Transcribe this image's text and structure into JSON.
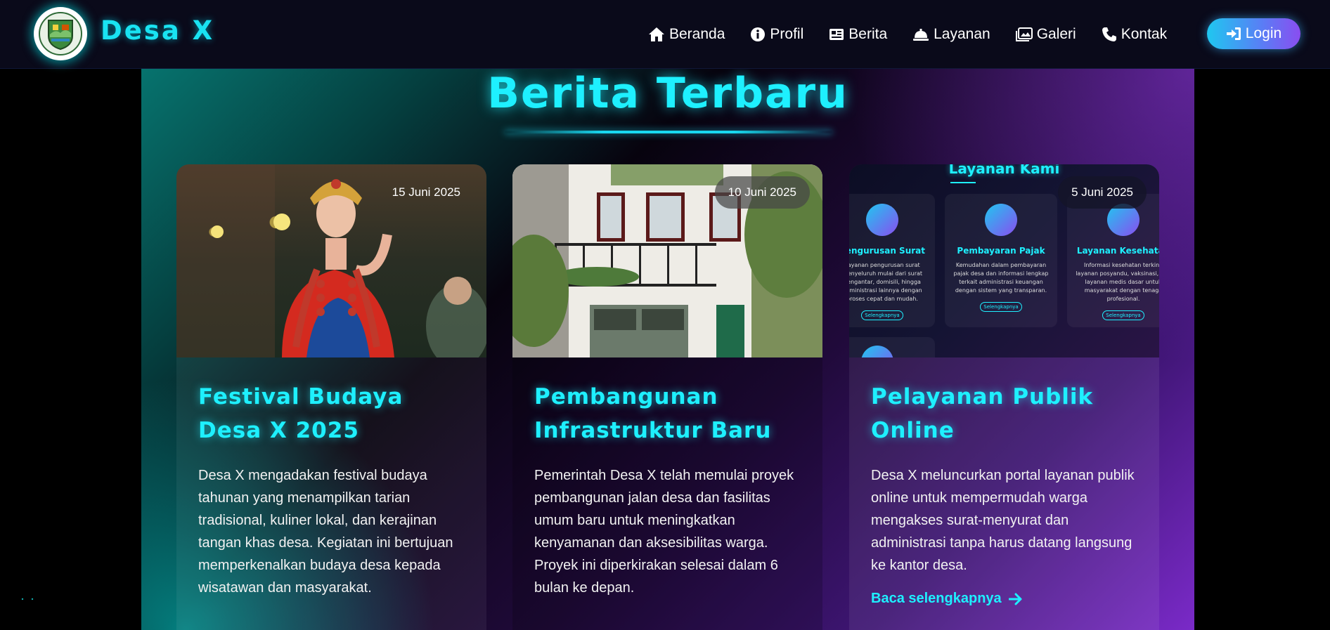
{
  "site": {
    "brand": "Desa X",
    "logo_text": "DESA X"
  },
  "nav": {
    "items": [
      {
        "label": "Beranda",
        "icon": "home-icon"
      },
      {
        "label": "Profil",
        "icon": "info-icon"
      },
      {
        "label": "Berita",
        "icon": "newspaper-icon"
      },
      {
        "label": "Layanan",
        "icon": "service-bell-icon"
      },
      {
        "label": "Galeri",
        "icon": "images-icon"
      },
      {
        "label": "Kontak",
        "icon": "phone-icon"
      }
    ],
    "login_label": "Login"
  },
  "section": {
    "title": "Berita Terbaru"
  },
  "cards": [
    {
      "date": "15 Juni 2025",
      "title": "Festival Budaya Desa X 2025",
      "text": "Desa X mengadakan festival budaya tahunan yang menampilkan tarian tradisional, kuliner lokal, dan kerajinan tangan khas desa. Kegiatan ini bertujuan memperkenalkan budaya desa kepada wisatawan dan masyarakat.",
      "read_more": ""
    },
    {
      "date": "10 Juni 2025",
      "title": "Pembangunan Infrastruktur Baru",
      "text": "Pemerintah Desa X telah memulai proyek pembangunan jalan desa dan fasilitas umum baru untuk meningkatkan kenyamanan dan aksesibilitas warga. Proyek ini diperkirakan selesai dalam 6 bulan ke depan.",
      "read_more": ""
    },
    {
      "date": "5 Juni 2025",
      "title": "Pelayanan Publik Online",
      "text": "Desa X meluncurkan portal layanan publik online untuk mempermudah warga mengakses surat-menyurat dan administrasi tanpa harus datang langsung ke kantor desa.",
      "read_more": "Baca selengkapnya"
    }
  ],
  "thumb3": {
    "heading": "Layanan Kami",
    "services": [
      {
        "title": "Pengurusan Surat",
        "text": "Layanan pengurusan surat menyeluruh mulai dari surat pengantar, domisili, hingga administrasi lainnya dengan proses cepat dan mudah.",
        "button": "Selengkapnya"
      },
      {
        "title": "Pembayaran Pajak",
        "text": "Kemudahan dalam pembayaran pajak desa dan informasi lengkap terkait administrasi keuangan dengan sistem yang transparan.",
        "button": "Selengkapnya"
      },
      {
        "title": "Layanan Kesehatan",
        "text": "Informasi kesehatan terkini, layanan posyandu, vaksinasi, dan layanan medis dasar untuk masyarakat dengan tenaga profesional.",
        "button": "Selengkapnya"
      }
    ]
  },
  "colors": {
    "accent": "#1ef0ff",
    "nav_bg": "#0a0a1a",
    "purple": "#7a2ac8",
    "teal": "#06736e"
  }
}
